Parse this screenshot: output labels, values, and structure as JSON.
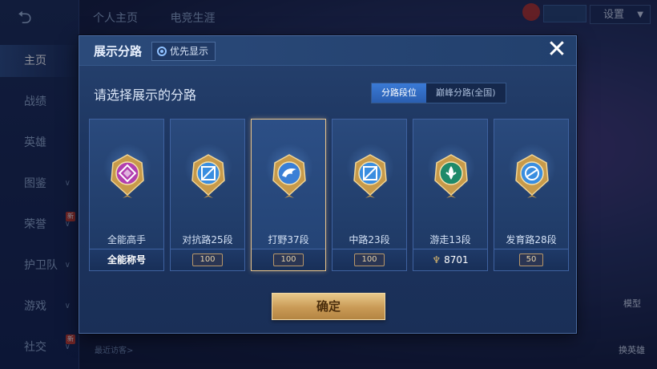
{
  "background": {
    "back_icon": "back-arrow-icon",
    "top_tabs": [
      "个人主页",
      "电竞生涯"
    ],
    "settings_label": "设置",
    "sidebar": [
      {
        "label": "主页",
        "active": true,
        "chevron": false,
        "new": false
      },
      {
        "label": "战绩",
        "active": false,
        "chevron": false,
        "new": false
      },
      {
        "label": "英雄",
        "active": false,
        "chevron": false,
        "new": false
      },
      {
        "label": "图鉴",
        "active": false,
        "chevron": true,
        "new": false
      },
      {
        "label": "荣誉",
        "active": false,
        "chevron": true,
        "new": true
      },
      {
        "label": "护卫队",
        "active": false,
        "chevron": true,
        "new": false
      },
      {
        "label": "游戏",
        "active": false,
        "chevron": true,
        "new": false
      },
      {
        "label": "社交",
        "active": false,
        "chevron": true,
        "new": true
      }
    ],
    "new_badge": "新",
    "right_model_label": "模型",
    "right_swap_label": "换英雄",
    "recent_visitors_label": "最近访客>"
  },
  "modal": {
    "title": "展示分路",
    "priority_label": "优先显示",
    "close_icon": "close-icon",
    "subtitle": "请选择展示的分路",
    "segments": [
      {
        "label": "分路段位",
        "active": true
      },
      {
        "label": "巅峰分路(全国)",
        "active": false
      }
    ],
    "cards": [
      {
        "name": "全能高手",
        "foot": "全能称号",
        "foot_type": "bold",
        "color": "#b23fb0",
        "selected": false
      },
      {
        "name": "对抗路25段",
        "foot": "100",
        "foot_type": "badge",
        "color": "#3a8ee0",
        "selected": false
      },
      {
        "name": "打野37段",
        "foot": "100",
        "foot_type": "badge",
        "color": "#3a7fd6",
        "selected": true
      },
      {
        "name": "中路23段",
        "foot": "100",
        "foot_type": "badge",
        "color": "#3a8ee0",
        "selected": false
      },
      {
        "name": "游走13段",
        "foot": "8701",
        "foot_type": "peak",
        "color": "#1f8a6a",
        "selected": false
      },
      {
        "name": "发育路28段",
        "foot": "50",
        "foot_type": "badge",
        "color": "#3a8ee0",
        "selected": false
      }
    ],
    "confirm_label": "确定"
  }
}
